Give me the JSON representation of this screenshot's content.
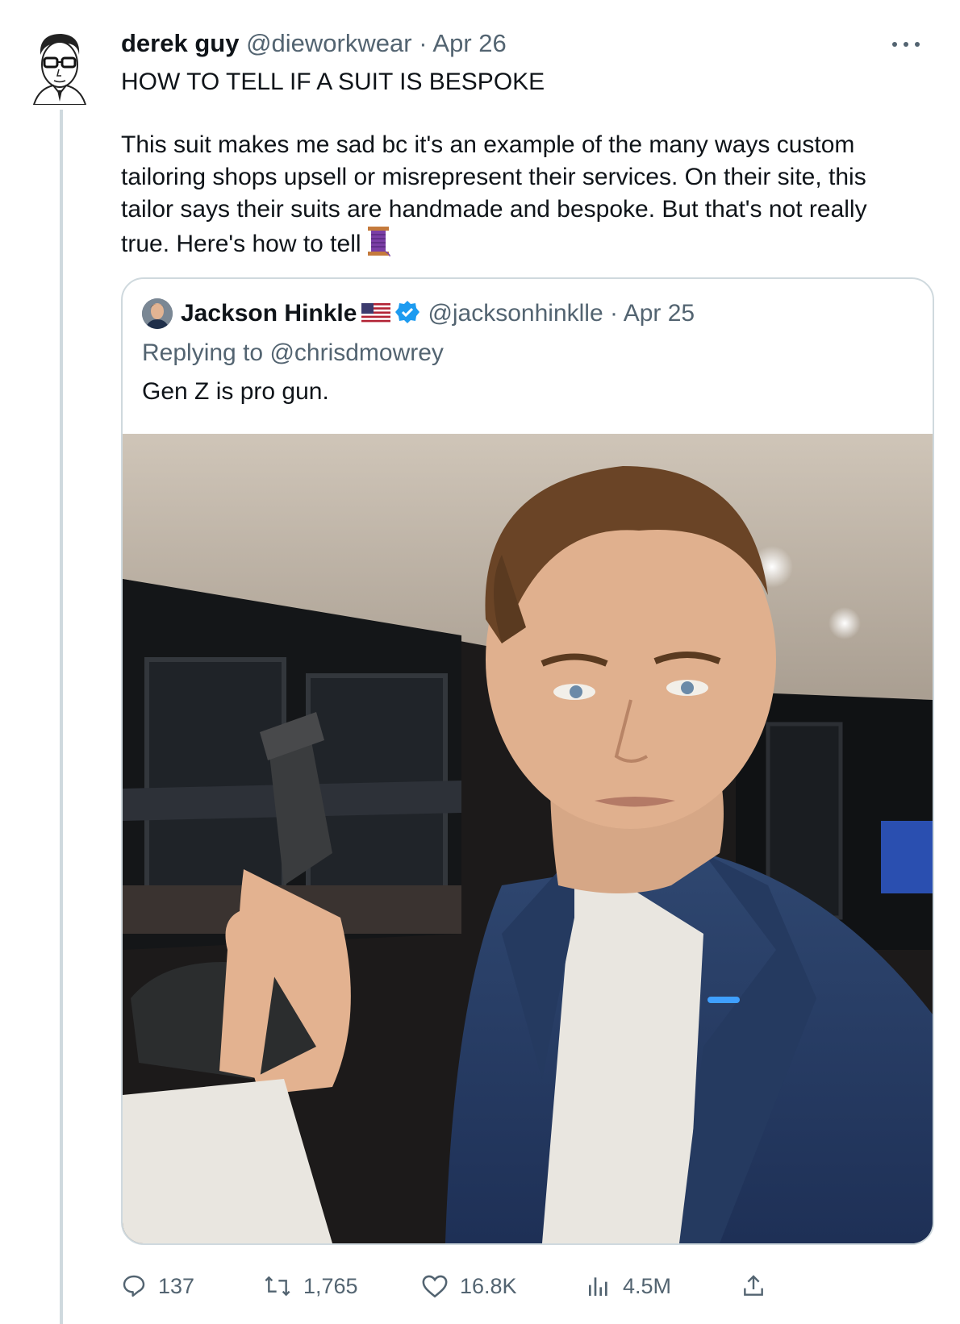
{
  "tweet": {
    "author_name": "derek guy",
    "author_handle": "@dieworkwear",
    "separator": "·",
    "date": "Apr 26",
    "headline": "HOW TO TELL IF A SUIT IS BESPOKE",
    "body": "This suit makes me sad bc it's an example of the many ways custom tailoring shops upsell or misrepresent their services. On their site, this tailor says their suits are handmade and bespoke. But that's not really true. Here's how to tell",
    "body_emoji": "spool-of-thread-icon"
  },
  "quoted": {
    "author_name": "Jackson Hinkle",
    "flag": "us-flag-icon",
    "verified": true,
    "author_handle": "@jacksonhinklle",
    "separator": "·",
    "date": "Apr 25",
    "reply_prefix": "Replying to",
    "reply_handle": "@chrisdmowrey",
    "text": "Gen Z is pro gun."
  },
  "actions": {
    "replies": "137",
    "retweets": "1,765",
    "likes": "16.8K",
    "views": "4.5M"
  },
  "colors": {
    "muted": "#536471",
    "border": "#cfd9de",
    "verified": "#1d9bf0",
    "text": "#0f1419"
  }
}
